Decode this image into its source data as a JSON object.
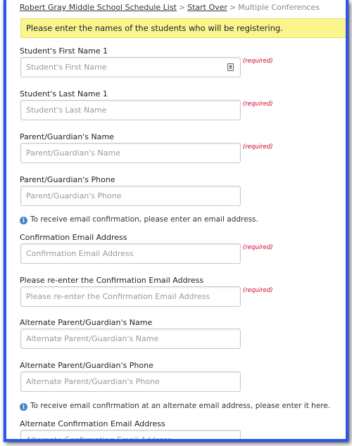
{
  "breadcrumb": {
    "school_link": "Robert Gray Middle School Schedule List",
    "separator": ">",
    "start_over_link": "Start Over",
    "current": "Multiple Conferences"
  },
  "notice": {
    "text": "Please enter the names of the students who will be registering."
  },
  "form": {
    "required_text": "(required)",
    "fields": [
      {
        "label": "Student's First Name 1",
        "placeholder": "Student's First Name",
        "value": "",
        "required": true
      },
      {
        "label": "Student's Last Name 1",
        "placeholder": "Student's Last Name",
        "value": "",
        "required": true
      },
      {
        "label": "Parent/Guardian's Name",
        "placeholder": "Parent/Guardian's Name",
        "value": "",
        "required": true
      },
      {
        "label": "Parent/Guardian's Phone",
        "placeholder": "Parent/Guardian's Phone",
        "value": "",
        "required": false
      },
      {
        "label": "Confirmation Email Address",
        "placeholder": "Confirmation Email Address",
        "value": "",
        "required": true
      },
      {
        "label": "Please re-enter the Confirmation Email Address",
        "placeholder": "Please re-enter the Confirmation Email Address",
        "value": "",
        "required": true
      },
      {
        "label": "Alternate Parent/Guardian's Name",
        "placeholder": "Alternate Parent/Guardian's Name",
        "value": "",
        "required": false
      },
      {
        "label": "Alternate Parent/Guardian's Phone",
        "placeholder": "Alternate Parent/Guardian's Phone",
        "value": "",
        "required": false
      },
      {
        "label": "Alternate Confirmation Email Address",
        "placeholder": "Alternate Confirmation Email Address",
        "value": "",
        "required": false
      }
    ],
    "info_email": "To receive email confirmation, please enter an email address.",
    "info_alt_email": "To receive email confirmation at an alternate email address, please enter it here."
  },
  "icons": {
    "info": "info-icon",
    "autofill": "contact-card-icon"
  },
  "colors": {
    "frame_border": "#2a57e8",
    "notice_bg": "#fbf58e",
    "required_text": "#d1002b",
    "info_icon": "#3f86c9"
  }
}
